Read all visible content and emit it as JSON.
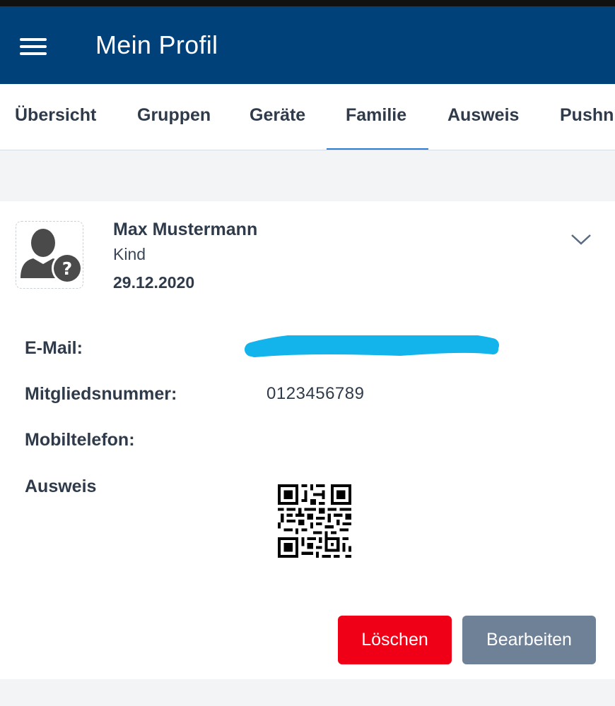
{
  "appbar": {
    "title": "Mein Profil",
    "menu_icon": "hamburger-menu-icon"
  },
  "tabs": [
    {
      "label": "Übersicht",
      "active": false
    },
    {
      "label": "Gruppen",
      "active": false
    },
    {
      "label": "Geräte",
      "active": false
    },
    {
      "label": "Familie",
      "active": true
    },
    {
      "label": "Ausweis",
      "active": false
    },
    {
      "label": "Pushn",
      "active": false
    }
  ],
  "member": {
    "name": "Max Mustermann",
    "role": "Kind",
    "date": "29.12.2020",
    "avatar_icon": "unknown-user-icon",
    "expand_icon": "chevron-down-icon"
  },
  "details": {
    "email_label": "E-Mail:",
    "member_number_label": "Mitgliedsnummer:",
    "member_number_value": "0123456789",
    "mobile_label": "Mobiltelefon:",
    "id_card_label": "Ausweis",
    "id_card_icon": "qr-code-icon"
  },
  "actions": {
    "delete_label": "Löschen",
    "edit_label": "Bearbeiten"
  },
  "colors": {
    "appbar": "#00417a",
    "tab_indicator": "#2d7dd2",
    "delete": "#ef0016",
    "edit": "#6e8197",
    "redaction": "#13b4ec"
  }
}
